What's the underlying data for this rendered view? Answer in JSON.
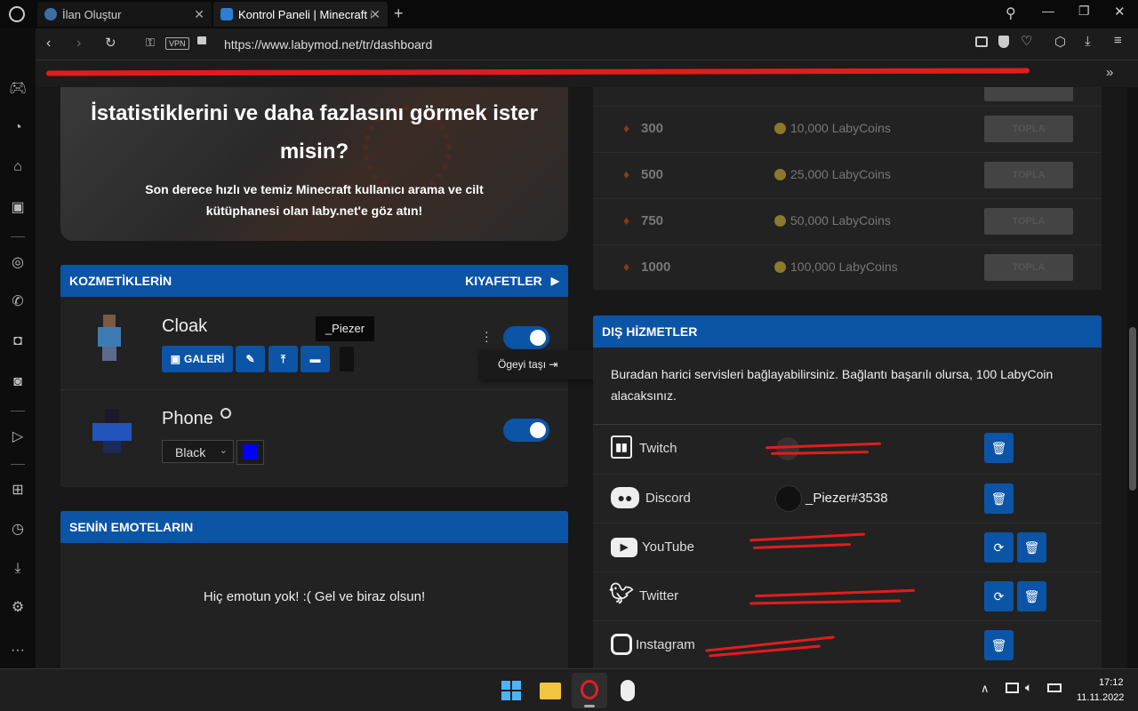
{
  "browser": {
    "tabs": [
      {
        "label": "İlan Oluştur",
        "active": false
      },
      {
        "label": "Kontrol Paneli | Minecraft ic",
        "active": true
      }
    ],
    "url": "https://www.labymod.net/tr/dashboard",
    "vpn_label": "VPN",
    "overflow": "»"
  },
  "banner": {
    "title": "İstatistiklerini ve daha fazlasını görmek ister misin?",
    "subtitle": "Son derece hızlı ve temiz Minecraft kullanıcı arama ve cilt kütüphanesi olan laby.net'e göz atın!"
  },
  "cosmetics": {
    "header": "KOZMETİKLERİN",
    "header_link": "KIYAFETLER",
    "items": [
      {
        "name": "Cloak",
        "gallery_label": "GALERİ",
        "tooltip": "_Piezer",
        "menu_item": "Ögeyi taşı",
        "enabled": true
      },
      {
        "name": "Phone",
        "select_value": "Black",
        "color": "#0000ff",
        "enabled": true
      }
    ]
  },
  "emotes": {
    "header": "SENİN EMOTELARIN",
    "empty_text": "Hiç emotun yok! :( Gel ve biraz olsun!"
  },
  "rewards": {
    "rows": [
      {
        "amount": "300",
        "coins": "10,000 LabyCoins",
        "button": "TOPLA"
      },
      {
        "amount": "500",
        "coins": "25,000 LabyCoins",
        "button": "TOPLA"
      },
      {
        "amount": "750",
        "coins": "50,000 LabyCoins",
        "button": "TOPLA"
      },
      {
        "amount": "1000",
        "coins": "100,000 LabyCoins",
        "button": "TOPLA"
      }
    ]
  },
  "services": {
    "header": "DIŞ HİZMETLER",
    "description": "Buradan harici servisleri bağlayabilirsiniz. Bağlantı başarılı olursa, 100 LabyCoin alacaksınız.",
    "items": [
      {
        "name": "Twitch",
        "account": "",
        "color": "#9146ff"
      },
      {
        "name": "Discord",
        "account": "_Piezer#3538",
        "color": "#5865f2"
      },
      {
        "name": "YouTube",
        "account": "",
        "color": "#ff0000"
      },
      {
        "name": "Twitter",
        "account": "",
        "color": "#1d9bf0"
      },
      {
        "name": "Instagram",
        "account": "",
        "color": "#c13584"
      }
    ]
  },
  "taskbar": {
    "time": "17:12",
    "date": "11.11.2022"
  }
}
